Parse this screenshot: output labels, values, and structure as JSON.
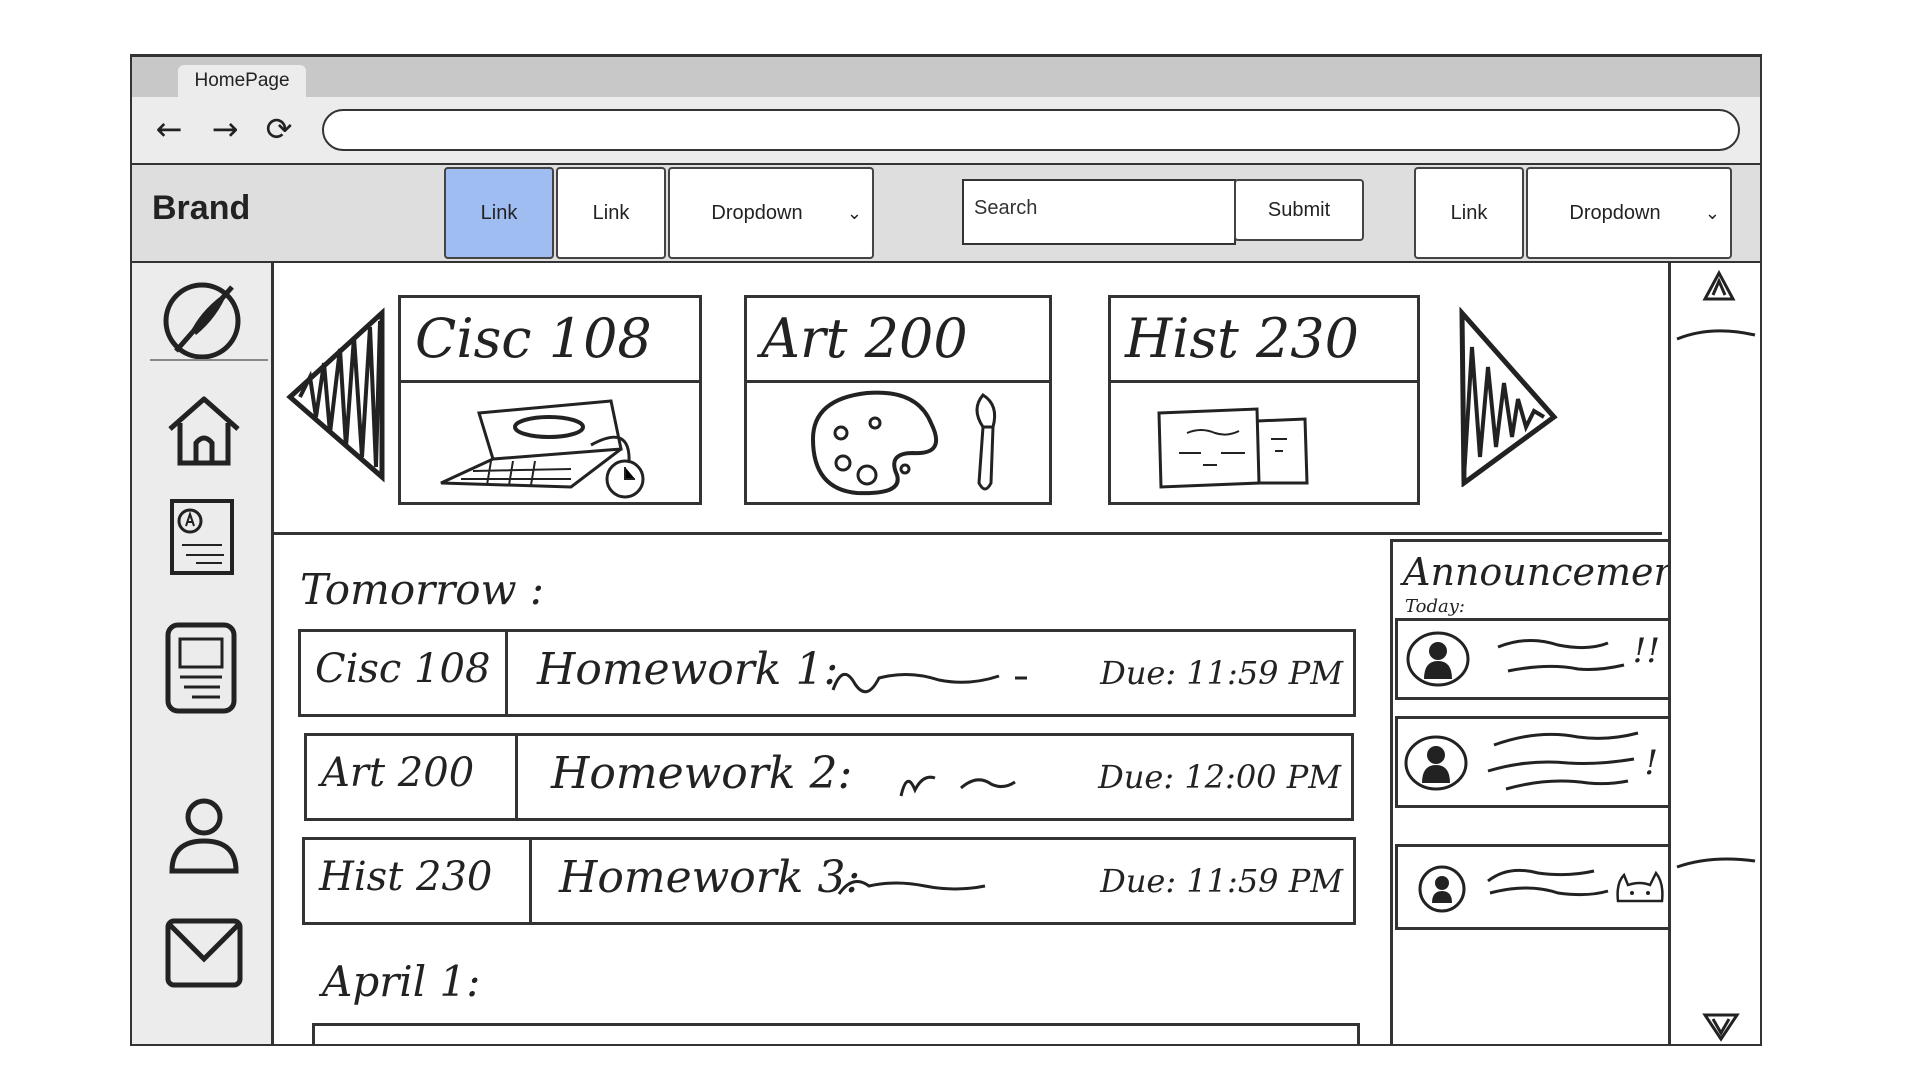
{
  "browser": {
    "tab_title": "HomePage",
    "back_glyph": "←",
    "forward_glyph": "→",
    "reload_glyph": "⟳"
  },
  "navbar": {
    "brand": "Brand",
    "link1": "Link",
    "link2": "Link",
    "dropdown1": "Dropdown",
    "search_placeholder": "Search",
    "submit": "Submit",
    "link3": "Link",
    "dropdown2": "Dropdown",
    "caret": "⌄",
    "active_color": "#9fbdf0"
  },
  "sidebar": {
    "icons": [
      "compass-icon",
      "home-icon",
      "document-icon",
      "notes-icon",
      "user-icon",
      "mail-icon"
    ]
  },
  "courses": [
    {
      "title": "Cisc 108",
      "icon": "laptop-icon"
    },
    {
      "title": "Art 200",
      "icon": "palette-icon"
    },
    {
      "title": "Hist 230",
      "icon": "papers-icon"
    }
  ],
  "tomorrow": {
    "label": "Tomorrow :",
    "items": [
      {
        "course": "Cisc 108",
        "title": "Homework 1:",
        "due": "Due: 11:59 PM"
      },
      {
        "course": "Art 200",
        "title": "Homework 2:",
        "due": "Due: 12:00 PM"
      },
      {
        "course": "Hist 230",
        "title": "Homework 3:",
        "due": "Due: 11:59 PM"
      }
    ]
  },
  "next_section": {
    "label": "April 1:"
  },
  "announcements": {
    "title": "Announcements:",
    "subtitle": "Today:",
    "items": [
      {
        "mark": "!!"
      },
      {
        "mark": "!"
      },
      {
        "mark": "cat-icon"
      }
    ]
  }
}
